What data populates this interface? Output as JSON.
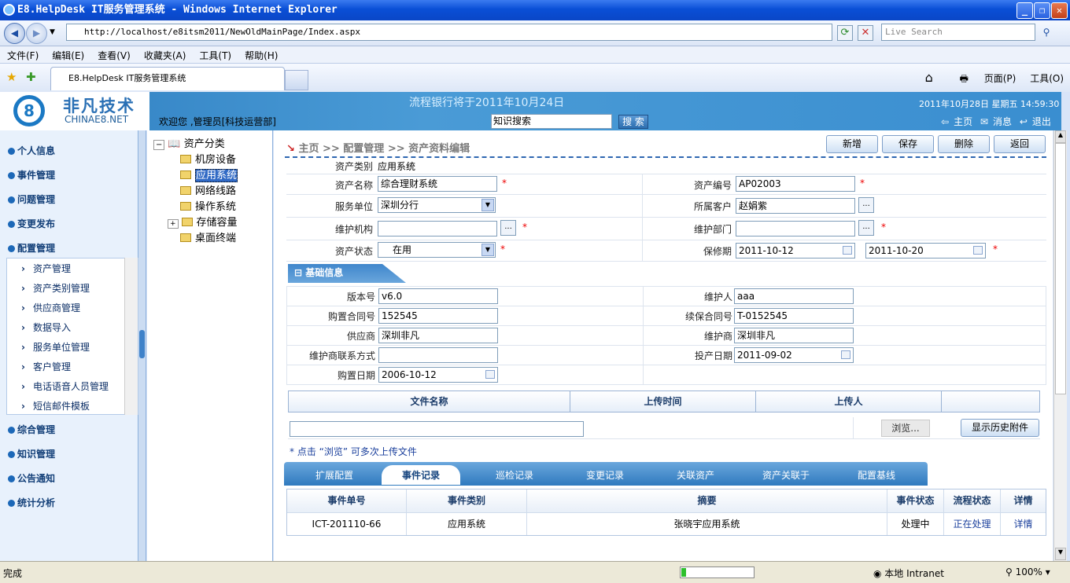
{
  "window": {
    "title": "E8.HelpDesk IT服务管理系统 - Windows Internet Explorer",
    "min": "_",
    "max": "❐",
    "close": "✕"
  },
  "browser": {
    "url": "http://localhost/e8itsm2011/NewOldMainPage/Index.aspx",
    "search_placeholder": "Live Search",
    "menu": [
      "文件(F)",
      "编辑(E)",
      "查看(V)",
      "收藏夹(A)",
      "工具(T)",
      "帮助(H)"
    ],
    "tab_title": "E8.HelpDesk IT服务管理系统",
    "cmd_home": "⌂",
    "cmd_print": "🖶",
    "cmd_page": "页面(P)",
    "cmd_tools": "工具(O)"
  },
  "header": {
    "logo_cn": "非凡技术",
    "logo_en": "CHINAE8.NET",
    "logo_mark": "8",
    "welcome": "欢迎您 ,管理员[科技运营部]",
    "banner": "流程银行将于2011年10月24日",
    "search_value": "知识搜索",
    "search_btn": "搜 索",
    "datetime": "2011年10月28日  星期五  14:59:30",
    "link_home": "主页",
    "link_msg": "消息",
    "link_logout": "退出"
  },
  "sidebar": {
    "sections": [
      "个人信息",
      "事件管理",
      "问题管理",
      "变更发布",
      "配置管理",
      "综合管理",
      "知识管理",
      "公告通知",
      "统计分析"
    ],
    "sub": [
      "资产管理",
      "资产类别管理",
      "供应商管理",
      "数据导入",
      "服务单位管理",
      "客户管理",
      "电话语音人员管理",
      "短信邮件模板"
    ]
  },
  "tree": {
    "root": "资产分类",
    "items": [
      "机房设备",
      "应用系统",
      "网络线路",
      "操作系统",
      "存储容量",
      "桌面终端"
    ]
  },
  "content": {
    "crumb": {
      "home": "主页",
      "sep1": " >> ",
      "l1": "配置管理",
      "sep2": " >> ",
      "l2": "资产资料编辑"
    },
    "buttons": {
      "new": "新增",
      "save": "保存",
      "delete": "删除",
      "back": "返回"
    },
    "form": {
      "type_label": "资产类别",
      "type_value": "应用系统",
      "name_label": "资产名称",
      "name_value": "综合理财系统",
      "code_label": "资产编号",
      "code_value": "AP02003",
      "unit_label": "服务单位",
      "unit_value": "深圳分行",
      "cust_label": "所属客户",
      "cust_value": "赵娟紫",
      "org_label": "维护机构",
      "org_value": "",
      "dept_label": "维护部门",
      "dept_value": "",
      "status_label": "资产状态",
      "status_value": "在用",
      "warranty_label": "保修期",
      "warranty_start": "2011-10-12",
      "warranty_end": "2011-10-20",
      "ellipsis": "...",
      "req": "*"
    },
    "basic": {
      "title": "基础信息",
      "version_label": "版本号",
      "version_value": "v6.0",
      "maintainer_label": "维护人",
      "maintainer_value": "aaa",
      "contract_label": "购置合同号",
      "contract_value": "152545",
      "renew_label": "续保合同号",
      "renew_value": "T-0152545",
      "supplier_label": "供应商",
      "supplier_value": "深圳非凡",
      "vendor_label": "维护商",
      "vendor_value": "深圳非凡",
      "contact_label": "维护商联系方式",
      "contact_value": "",
      "prod_label": "投产日期",
      "prod_value": "2011-09-02",
      "buy_label": "购置日期",
      "buy_value": "2006-10-12"
    },
    "files": {
      "headers": [
        "文件名称",
        "上传时间",
        "上传人"
      ],
      "browse": "浏览...",
      "history": "显示历史附件",
      "hint": "* 点击 “浏览” 可多次上传文件"
    },
    "tabs": [
      "扩展配置",
      "事件记录",
      "巡检记录",
      "变更记录",
      "关联资产",
      "资产关联于",
      "配置基线"
    ],
    "events": {
      "headers": [
        "事件单号",
        "事件类别",
        "摘要",
        "事件状态",
        "流程状态",
        "详情"
      ],
      "rows": [
        [
          "ICT-201110-66",
          "应用系统",
          "张晓宇应用系统",
          "处理中",
          "正在处理",
          "详情"
        ]
      ]
    }
  },
  "status": {
    "left": "完成",
    "zone": "本地 Intranet",
    "zoom": "100%"
  }
}
